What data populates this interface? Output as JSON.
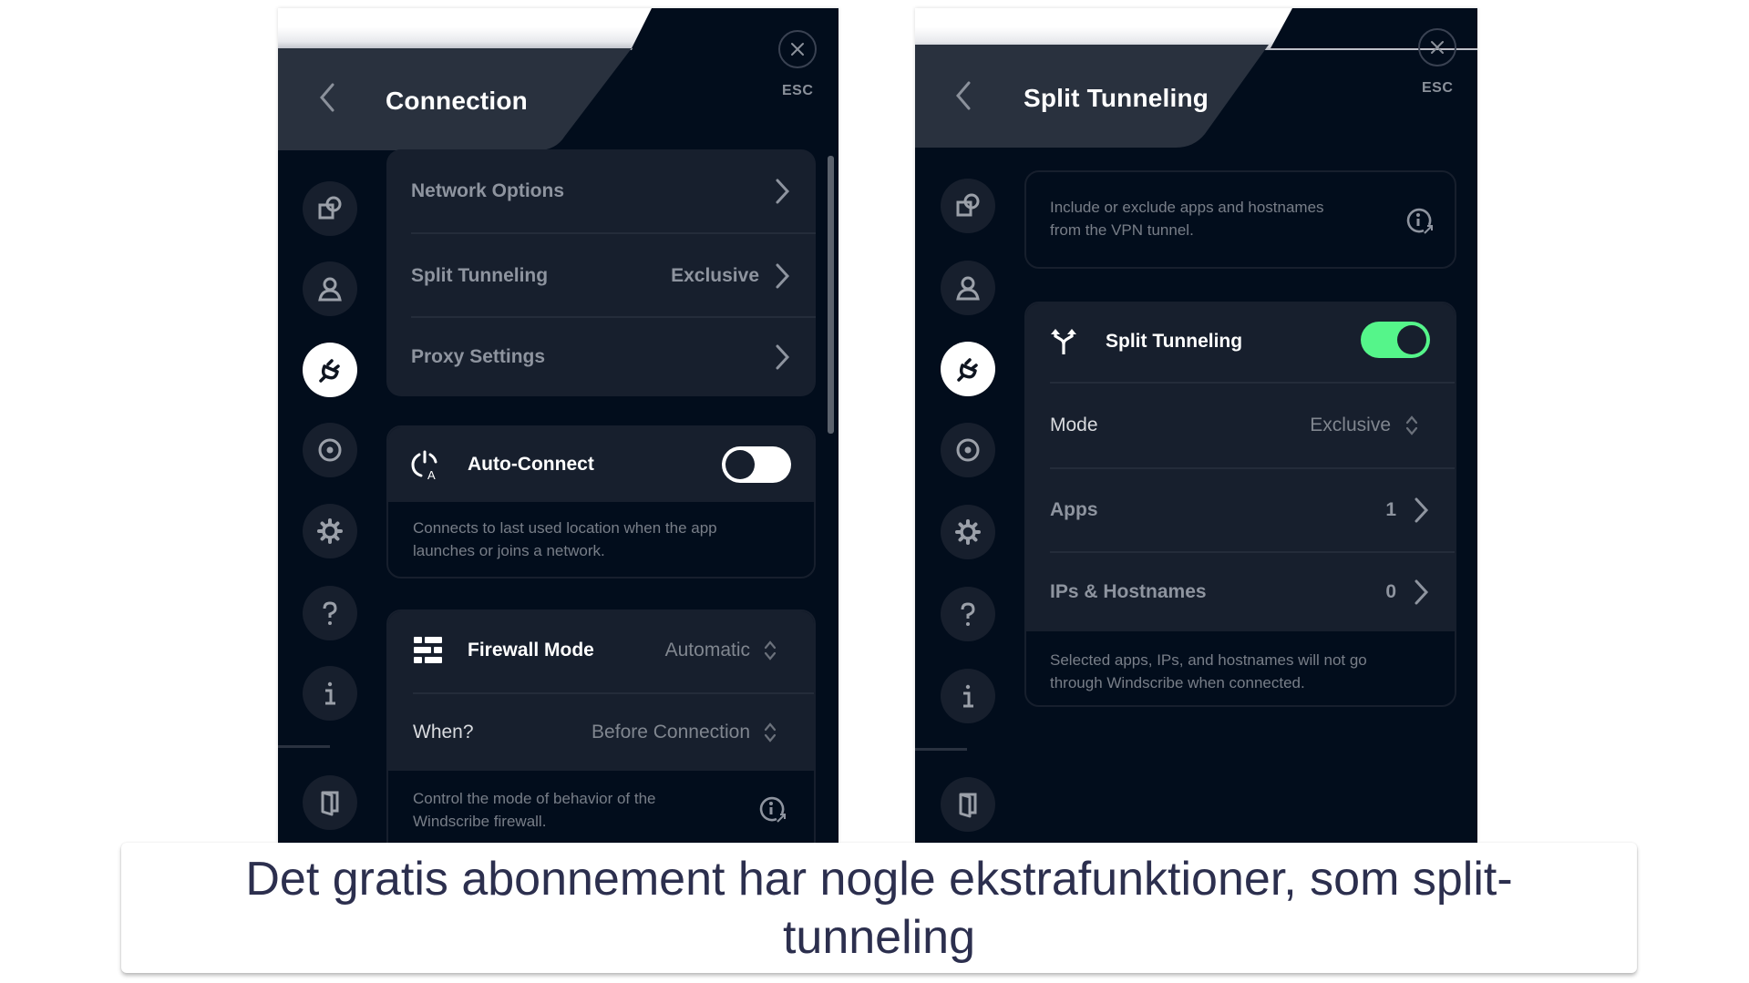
{
  "colors": {
    "panel_bg": "#020d1c",
    "card_bg": "#171f2d",
    "header_bg": "#29313e",
    "toggle_on": "#55f58a",
    "caption_text": "#2c2f4e"
  },
  "left_panel": {
    "title": "Connection",
    "esc_label": "ESC",
    "sidebar": [
      {
        "icon": "general-icon",
        "active": false
      },
      {
        "icon": "account-icon",
        "active": false
      },
      {
        "icon": "connection-plug-icon",
        "active": true
      },
      {
        "icon": "robert-icon",
        "active": false
      },
      {
        "icon": "gear-icon",
        "active": false
      },
      {
        "icon": "help-icon",
        "active": false
      },
      {
        "icon": "info-icon",
        "active": false
      },
      {
        "icon": "logout-door-icon",
        "active": false
      }
    ],
    "menu": [
      {
        "label": "Network Options",
        "value": ""
      },
      {
        "label": "Split Tunneling",
        "value": "Exclusive"
      },
      {
        "label": "Proxy Settings",
        "value": ""
      }
    ],
    "auto_connect": {
      "label": "Auto-Connect",
      "enabled": false,
      "description_line1": "Connects to last used location when the app",
      "description_line2": "launches or joins a network."
    },
    "firewall": {
      "label": "Firewall Mode",
      "value": "Automatic",
      "when_label": "When?",
      "when_value": "Before Connection",
      "description_line1": "Control the mode of behavior of the",
      "description_line2": "Windscribe firewall."
    }
  },
  "right_panel": {
    "title": "Split Tunneling",
    "esc_label": "ESC",
    "sidebar": [
      {
        "icon": "general-icon",
        "active": false
      },
      {
        "icon": "account-icon",
        "active": false
      },
      {
        "icon": "connection-plug-icon",
        "active": true
      },
      {
        "icon": "robert-icon",
        "active": false
      },
      {
        "icon": "gear-icon",
        "active": false
      },
      {
        "icon": "help-icon",
        "active": false
      },
      {
        "icon": "info-icon",
        "active": false
      },
      {
        "icon": "logout-door-icon",
        "active": false
      }
    ],
    "info": {
      "line1": "Include or exclude apps and hostnames",
      "line2": "from the VPN tunnel."
    },
    "split_tunneling": {
      "label": "Split Tunneling",
      "enabled": true,
      "mode_label": "Mode",
      "mode_value": "Exclusive",
      "apps_label": "Apps",
      "apps_count": "1",
      "ips_label": "IPs & Hostnames",
      "ips_count": "0",
      "description_line1": "Selected apps, IPs, and hostnames will not go",
      "description_line2": "through Windscribe when connected."
    }
  },
  "caption": {
    "text": "Det gratis abonnement har nogle ekstrafunktioner, som split-tunneling"
  }
}
